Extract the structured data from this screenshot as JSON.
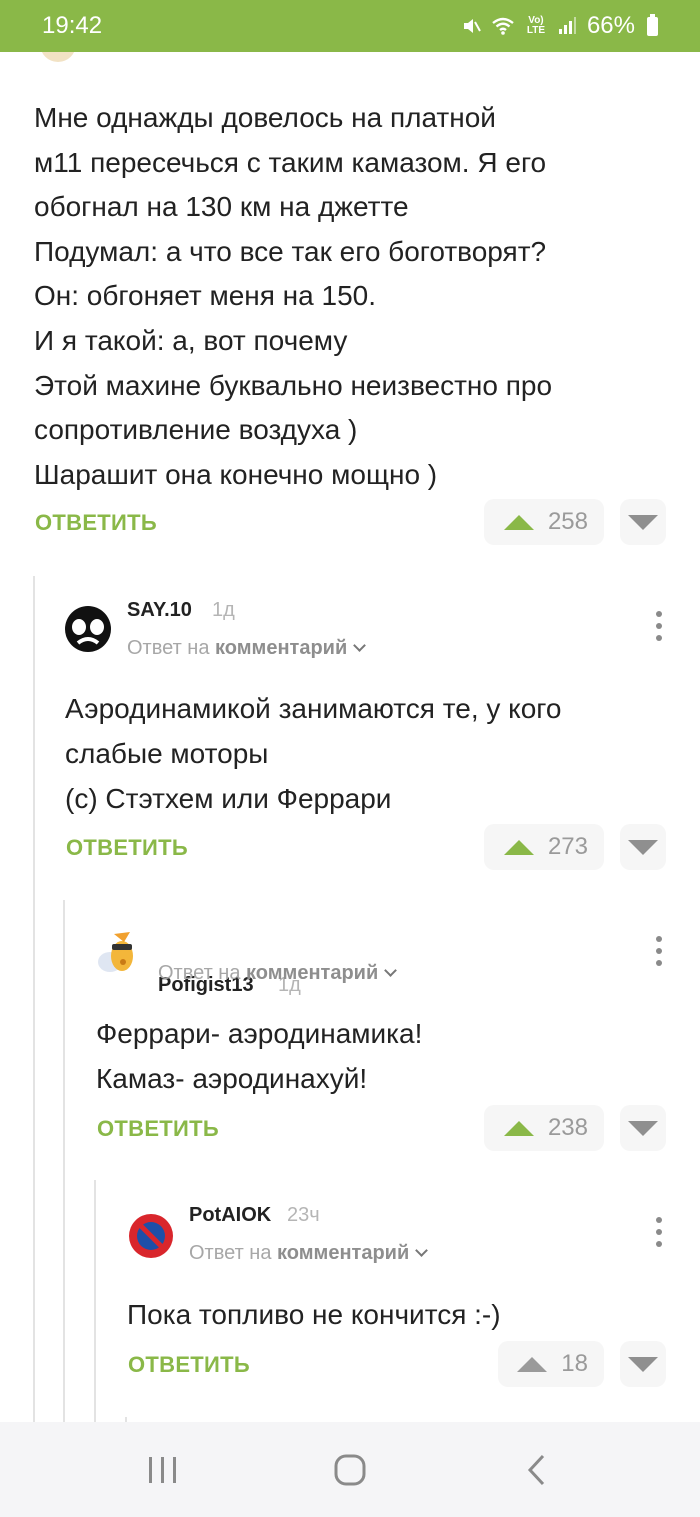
{
  "status_bar": {
    "time": "19:42",
    "battery": "66%",
    "icons": [
      "mute-icon",
      "wifi-icon",
      "volte-icon",
      "signal-icon",
      "battery-icon"
    ],
    "volte_label": "Vo) LTE"
  },
  "post": {
    "text": "Мне однажды довелось на платной\nм11 пересечься с таким камазом. Я его\nобогнал на 130 км на джетте\nПодумал: а что все так его боготворят?\nОн: обгоняет меня на 150.\n И я такой: а, вот почему\nЭтой махине буквально неизвестно про\nсопротивление воздуха )\nШарашит она конечно мощно )",
    "reply_label": "ОТВЕТИТЬ",
    "rating": "258"
  },
  "comments": [
    {
      "user": "SAY.10",
      "time": "1д",
      "reply_prefix": "Ответ на",
      "reply_target": "комментарий",
      "text": "Аэродинамикой занимаются те, у кого\nслабые моторы\n(с) Стэтхем или Феррари",
      "reply_label": "ОТВЕТИТЬ",
      "rating": "273"
    },
    {
      "user": "Pofigist13",
      "time": "1д",
      "reply_prefix": "Ответ на",
      "reply_target": "комментарий",
      "text": "Феррари- аэродинамика!\nКамаз- аэродинахуй!",
      "reply_label": "ОТВЕТИТЬ",
      "rating": "238"
    },
    {
      "user": "PotAIOK",
      "time": "23ч",
      "reply_prefix": "Ответ на",
      "reply_target": "комментарий",
      "text": "Пока топливо не кончится :-)",
      "reply_label": "ОТВЕТИТЬ",
      "rating": "18"
    }
  ],
  "colors": {
    "accent": "#8ab848",
    "status_bar": "#8ab848",
    "vote_bg": "#f6f6f6",
    "thread_line": "#e3e3e3"
  }
}
